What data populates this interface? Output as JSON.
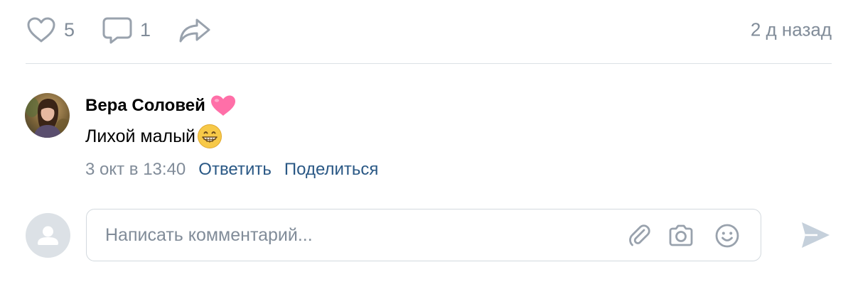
{
  "post_actions": {
    "like": {
      "icon": "heart-outline-icon",
      "count": "5"
    },
    "comment": {
      "icon": "speech-bubble-icon",
      "count": "1"
    },
    "share": {
      "icon": "share-arrow-icon"
    },
    "time_ago": "2 д назад"
  },
  "comment": {
    "author": "Вера Соловей",
    "author_emoji": "pink-heart-emoji",
    "text": "Лихой малый",
    "text_emoji": "grinning-face-emoji",
    "date": "3 окт в 13:40",
    "reply_label": "Ответить",
    "share_label": "Поделиться"
  },
  "composer": {
    "placeholder": "Написать комментарий...",
    "icons": [
      "paperclip-icon",
      "camera-icon",
      "smiley-icon"
    ],
    "send_icon": "send-arrow-icon"
  },
  "colors": {
    "muted": "#818c99",
    "link": "#2a5885",
    "divider": "#dce1e6",
    "icon": "#99a2ad",
    "heart_pink": "#ff6fa8",
    "send_disabled": "#c5d0db"
  }
}
